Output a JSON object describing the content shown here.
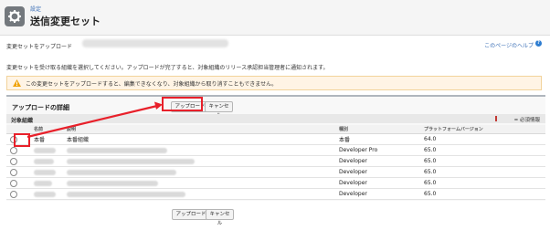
{
  "header": {
    "breadcrumb": "設定",
    "title": "送信変更セット"
  },
  "intro": {
    "upload_heading": "変更セットをアップロード",
    "help_link": "このページのヘルプ",
    "help_icon_text": "?",
    "description": "変更セットを受け取る組織を選択してください。アップロードが完了すると、対象組織のリリース承認担当管理者に通知されます。"
  },
  "warning": {
    "text": "この変更セットをアップロードすると、編集できなくなり、対象組織から取り消すこともできません。"
  },
  "detail": {
    "title": "アップロードの詳細",
    "upload_label": "アップロード",
    "cancel_label": "キャンセル",
    "section_label": "対象組織",
    "required_text": "= 必須情報"
  },
  "table": {
    "columns": [
      "名前",
      "説明",
      "種別",
      "プラットフォームバージョン"
    ],
    "rows": [
      {
        "name": "本番",
        "description": "本番組織",
        "type": "本番",
        "version": "64.0"
      },
      {
        "name": "",
        "description": "",
        "type": "Developer Pro",
        "version": "65.0"
      },
      {
        "name": "",
        "description": "",
        "type": "Developer",
        "version": "65.0"
      },
      {
        "name": "",
        "description": "",
        "type": "Developer",
        "version": "65.0"
      },
      {
        "name": "",
        "description": "",
        "type": "Developer",
        "version": "65.0"
      },
      {
        "name": "",
        "description": "",
        "type": "Developer",
        "version": "65.0"
      }
    ]
  },
  "footer": {
    "upload_label": "アップロード",
    "cancel_label": "キャンセル"
  },
  "colors": {
    "annotation": "#e8202a",
    "link": "#3b6fb6",
    "warning_bg": "#fff4e5"
  }
}
